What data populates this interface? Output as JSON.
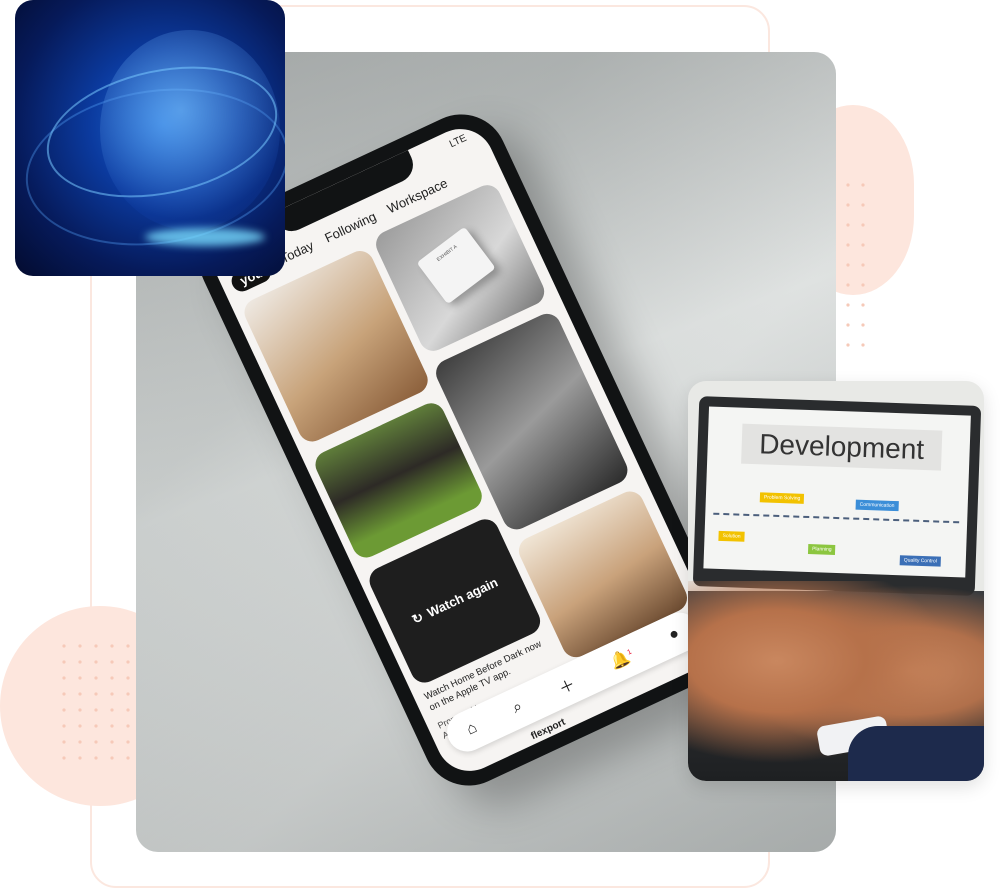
{
  "colors": {
    "accent_peach": "#fde6dd",
    "dots": "#f6c9b8",
    "globe_blue": "#0b3a9e"
  },
  "phone_app": {
    "status": "LTE",
    "tabs": [
      {
        "label": "you",
        "active": true
      },
      {
        "label": "Today",
        "active": false
      },
      {
        "label": "Following",
        "active": false
      },
      {
        "label": "Workspace",
        "active": false
      }
    ],
    "box_label": "EXHIBIT A",
    "watch_again": "Watch again",
    "caption": "Watch Home Before Dark now on the Apple TV app.",
    "promoted_by": "Promoted by",
    "promoter": "Apple TV",
    "notification_count": "1",
    "brand": "flexport"
  },
  "laptop": {
    "title": "Development",
    "tags": [
      {
        "label": "Problem Solving",
        "color": "#f2c200"
      },
      {
        "label": "Solution",
        "color": "#f2c200"
      },
      {
        "label": "Planning",
        "color": "#8cc63f"
      },
      {
        "label": "Communication",
        "color": "#3b8ed8"
      },
      {
        "label": "Quality Control",
        "color": "#3b6fb6"
      }
    ]
  },
  "icons": [
    "globe-icon",
    "home-icon",
    "search-icon",
    "plus-icon",
    "bell-icon",
    "profile-icon",
    "refresh-icon"
  ]
}
